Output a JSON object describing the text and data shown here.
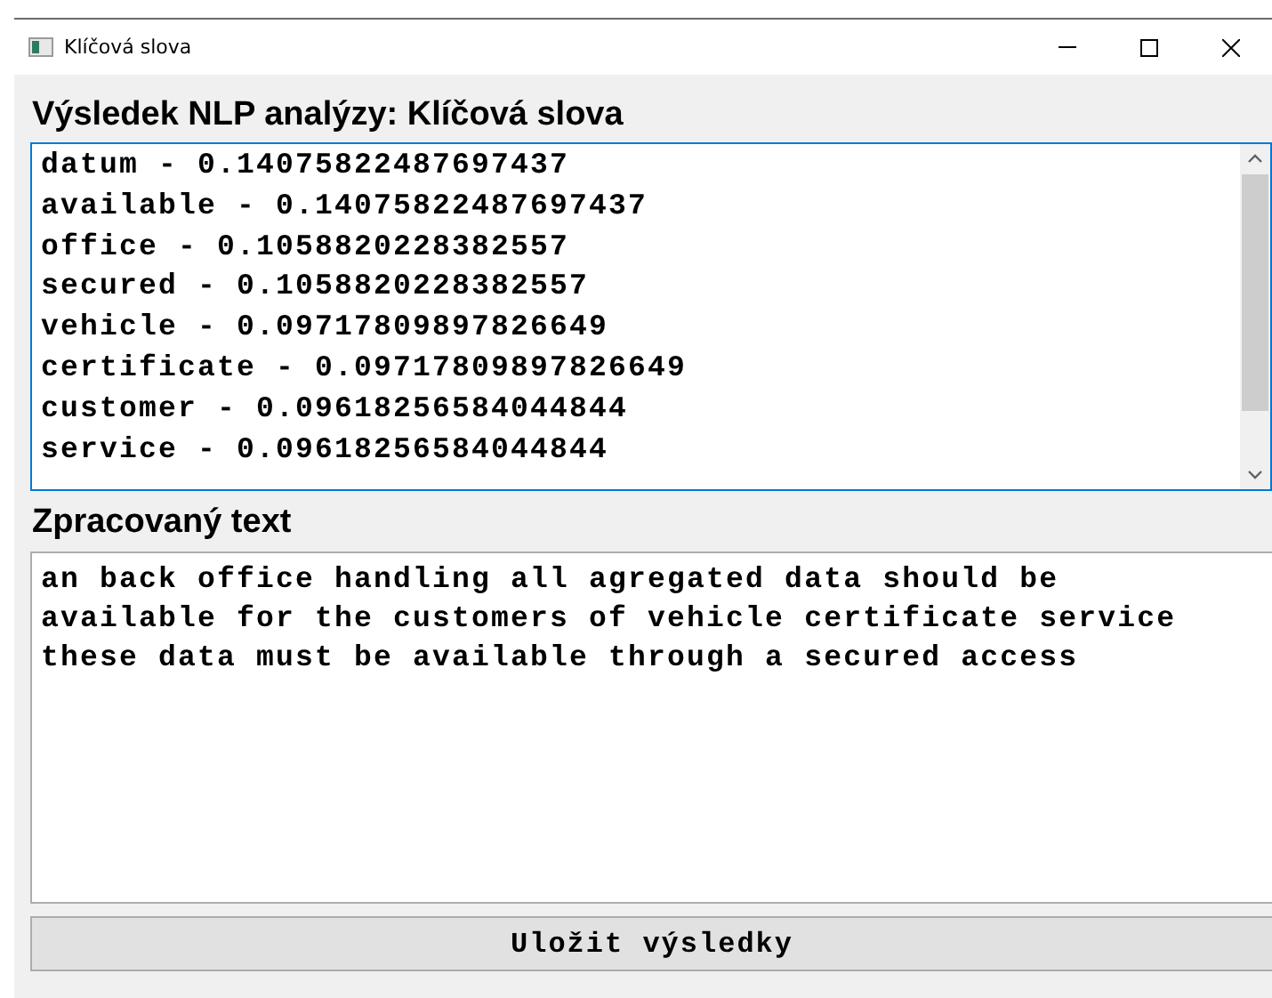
{
  "window": {
    "title": "Klíčová slova"
  },
  "keywords_heading": "Výsledek NLP analýzy: Klíčová slova",
  "keywords": [
    "datum - 0.14075822487697437",
    "available - 0.14075822487697437",
    "office - 0.1058820228382557",
    "secured - 0.1058820228382557",
    "vehicle - 0.09717809897826649",
    "certificate - 0.09717809897826649",
    "customer - 0.09618256584044844",
    "service - 0.09618256584044844"
  ],
  "processed_heading": "Zpracovaný text",
  "processed_text": [
    "an back office handling all agregated data should be",
    "available for the customers of vehicle certificate service",
    "these data must be available through a secured access"
  ],
  "save_button": "Uložit výsledky"
}
